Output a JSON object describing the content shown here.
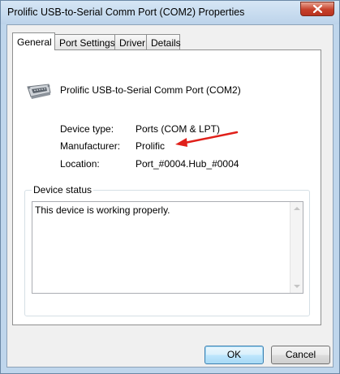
{
  "window": {
    "title": "Prolific USB-to-Serial Comm Port (COM2) Properties",
    "close_icon": "close-icon"
  },
  "tabs": [
    {
      "label": "General",
      "active": true
    },
    {
      "label": "Port Settings",
      "active": false
    },
    {
      "label": "Driver",
      "active": false
    },
    {
      "label": "Details",
      "active": false
    }
  ],
  "general": {
    "device_icon": "serial-port-icon",
    "device_name": "Prolific USB-to-Serial Comm Port (COM2)",
    "properties": [
      {
        "label": "Device type:",
        "value": "Ports (COM & LPT)"
      },
      {
        "label": "Manufacturer:",
        "value": "Prolific"
      },
      {
        "label": "Location:",
        "value": "Port_#0004.Hub_#0004"
      }
    ],
    "annotation": {
      "icon": "red-arrow-icon",
      "color": "#e0201a"
    },
    "device_status": {
      "label": "Device status",
      "text": "This device is working properly."
    }
  },
  "buttons": {
    "ok": "OK",
    "cancel": "Cancel"
  }
}
